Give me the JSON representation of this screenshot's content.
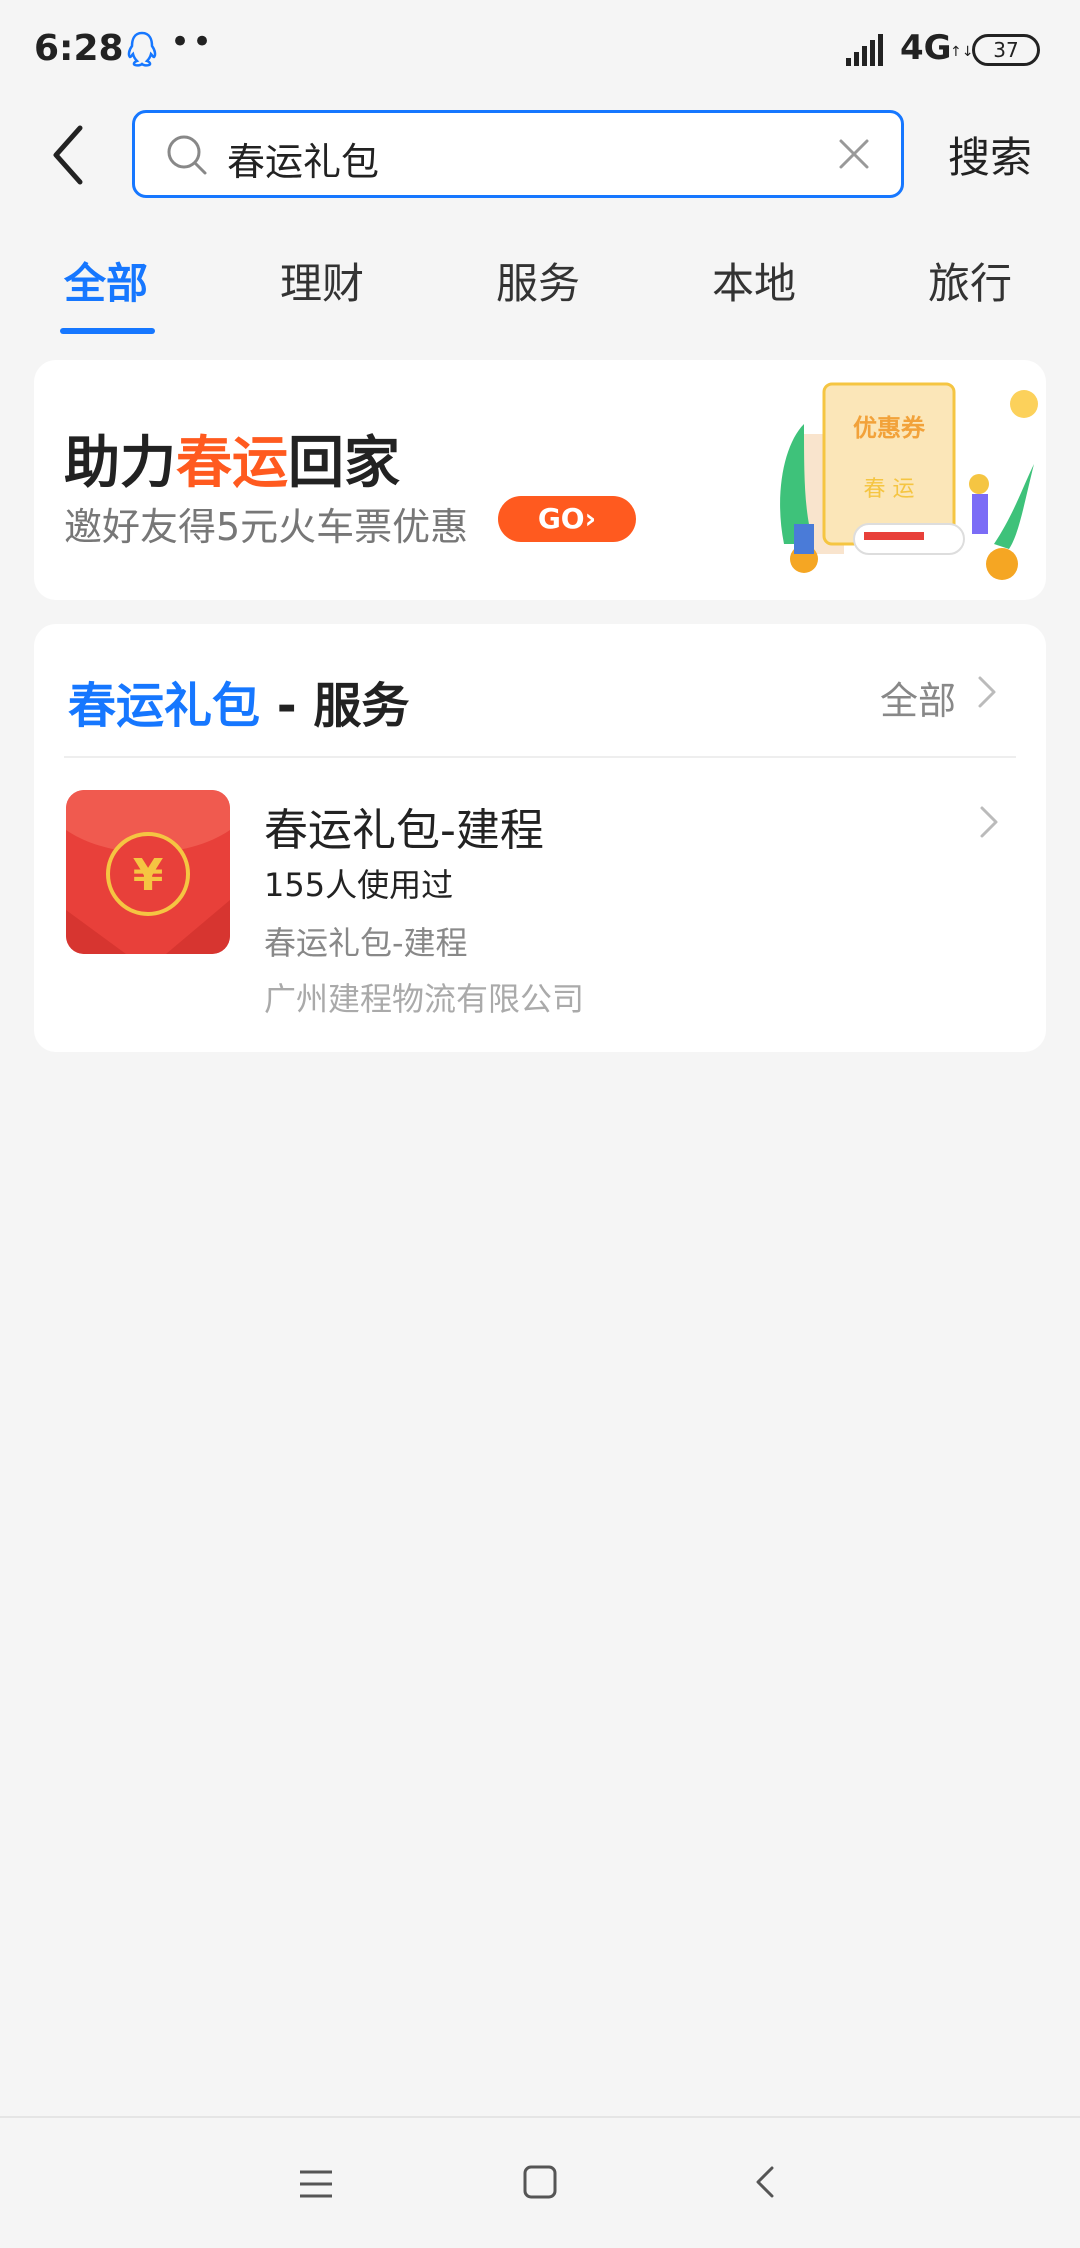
{
  "status_bar": {
    "time": "6:28",
    "dots": "••",
    "network": "4G",
    "battery": "37"
  },
  "search": {
    "query": "春运礼包",
    "search_button_label": "搜索"
  },
  "tabs": [
    {
      "label": "全部",
      "active": true
    },
    {
      "label": "理财",
      "active": false
    },
    {
      "label": "服务",
      "active": false
    },
    {
      "label": "本地",
      "active": false
    },
    {
      "label": "旅行",
      "active": false
    }
  ],
  "banner": {
    "title_prefix": "助力",
    "title_accent": "春运",
    "title_suffix": "回家",
    "subtitle": "邀好友得5元火车票优惠",
    "go_label": "GO",
    "coupon_label": "优惠券",
    "coupon_sub": "春 运",
    "accent_color": "#ff5a1f"
  },
  "results_section": {
    "keyword": "春运礼包",
    "category": " - 服务",
    "see_all_label": "全部",
    "items": [
      {
        "name": "春运礼包-建程",
        "usage": "155人使用过",
        "description": "春运礼包-建程",
        "company": "广州建程物流有限公司",
        "icon": "red-envelope-yuan-icon"
      }
    ]
  },
  "colors": {
    "brand": "#1677ff",
    "background": "#f5f5f5",
    "red_envelope": "#e8403a",
    "gold": "#f5c542"
  },
  "nav_bar": {
    "menu_icon": "menu-icon",
    "home_icon": "home-icon",
    "back_icon": "back-icon"
  }
}
